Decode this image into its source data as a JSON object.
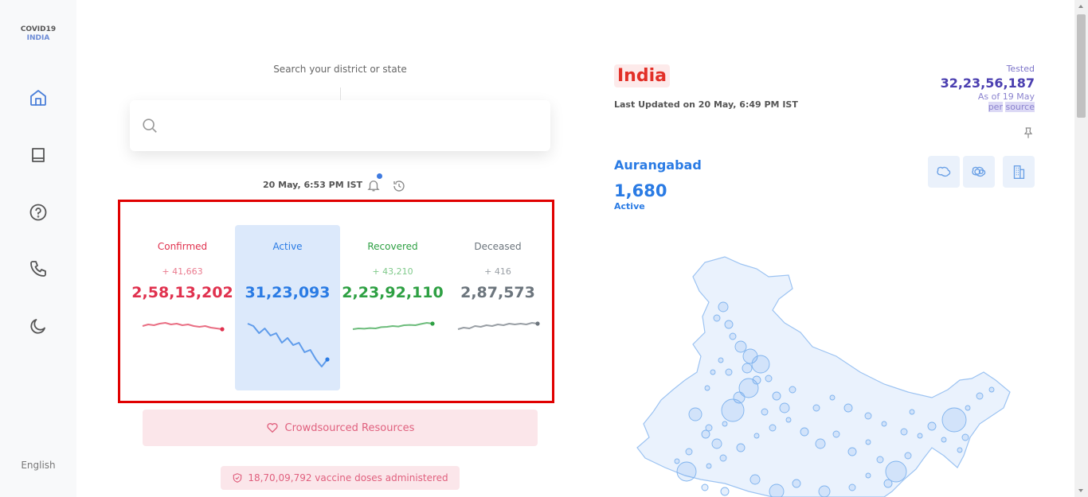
{
  "brand": {
    "line1": "COVID19",
    "line2": "INDIA"
  },
  "sidebar": {
    "items": [
      {
        "icon": "home-icon"
      },
      {
        "icon": "book-icon"
      },
      {
        "icon": "help-icon"
      },
      {
        "icon": "phone-icon"
      },
      {
        "icon": "moon-icon"
      }
    ],
    "language": "English"
  },
  "search": {
    "label": "Search your district or state",
    "placeholder": ""
  },
  "timestamp": "20 May, 6:53 PM IST",
  "stats": [
    {
      "key": "confirmed",
      "title": "Confirmed",
      "delta": "+ 41,663",
      "total": "2,58,13,202",
      "color": "#e0314e",
      "delta_color": "#ea7a8e",
      "trend": [
        0.55,
        0.45,
        0.5,
        0.4,
        0.35,
        0.45,
        0.4,
        0.5,
        0.45,
        0.55,
        0.6,
        0.55,
        0.65,
        0.7,
        0.75
      ]
    },
    {
      "key": "active",
      "title": "Active",
      "delta": "",
      "total": "31,23,093",
      "color": "#2a7be4",
      "delta_color": "#2a7be4",
      "trend": [
        0.1,
        0.15,
        0.3,
        0.2,
        0.35,
        0.3,
        0.5,
        0.4,
        0.55,
        0.5,
        0.7,
        0.65,
        0.85,
        1.0,
        0.85
      ]
    },
    {
      "key": "recovered",
      "title": "Recovered",
      "delta": "+ 43,210",
      "total": "2,23,92,110",
      "color": "#2ea043",
      "delta_color": "#7fc98a",
      "trend": [
        0.75,
        0.7,
        0.72,
        0.68,
        0.7,
        0.62,
        0.6,
        0.55,
        0.58,
        0.5,
        0.48,
        0.5,
        0.42,
        0.35,
        0.4
      ]
    },
    {
      "key": "deceased",
      "title": "Deceased",
      "delta": "+ 416",
      "total": "2,87,573",
      "color": "#6c757d",
      "delta_color": "#9aa0a6",
      "trend": [
        0.75,
        0.65,
        0.7,
        0.55,
        0.6,
        0.5,
        0.55,
        0.45,
        0.5,
        0.4,
        0.45,
        0.4,
        0.45,
        0.35,
        0.4
      ]
    }
  ],
  "resources": {
    "label": "Crowdsourced Resources"
  },
  "vaccine": {
    "label": "18,70,09,792 vaccine doses administered"
  },
  "state": {
    "name": "India",
    "last_updated": "Last Updated on 20 May, 6:49 PM IST",
    "tested_label": "Tested",
    "tested_value": "32,23,56,187",
    "tested_asof": "As of 19 May",
    "tested_per": "per",
    "tested_source": "source"
  },
  "district": {
    "name": "Aurangabad",
    "value": "1,680",
    "label": "Active"
  },
  "map_buttons": [
    {
      "icon": "district-map-icon"
    },
    {
      "icon": "bubble-map-icon"
    },
    {
      "icon": "building-icon"
    }
  ],
  "colors": {
    "confirmed": "#e0314e",
    "active": "#2a7be4",
    "recovered": "#2ea043",
    "deceased": "#6c757d",
    "tested": "#4b3fb0"
  }
}
